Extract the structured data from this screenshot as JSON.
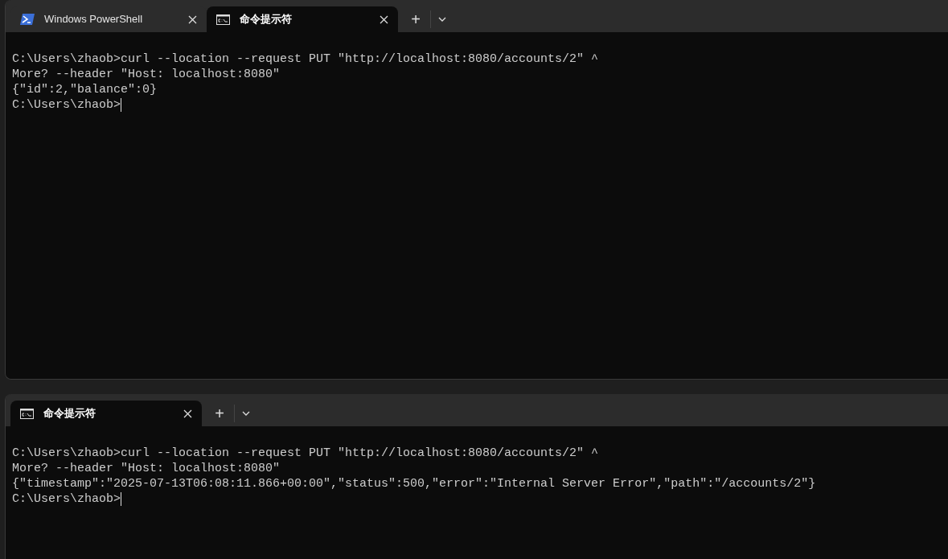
{
  "windows": [
    {
      "tabs": [
        {
          "kind": "powershell",
          "title": "Windows PowerShell",
          "selected": false
        },
        {
          "kind": "cmd",
          "title": "命令提示符",
          "selected": true
        }
      ],
      "new_tab": "+",
      "lines": [
        "C:\\Users\\zhaob>curl --location --request PUT \"http://localhost:8080/accounts/2\" ^",
        "More? --header \"Host: localhost:8080\"",
        "{\"id\":2,\"balance\":0}",
        "C:\\Users\\zhaob>"
      ]
    },
    {
      "tabs": [
        {
          "kind": "cmd",
          "title": "命令提示符",
          "selected": true
        }
      ],
      "new_tab": "+",
      "lines": [
        "C:\\Users\\zhaob>curl --location --request PUT \"http://localhost:8080/accounts/2\" ^",
        "More? --header \"Host: localhost:8080\"",
        "{\"timestamp\":\"2025-07-13T06:08:11.866+00:00\",\"status\":500,\"error\":\"Internal Server Error\",\"path\":\"/accounts/2\"}",
        "C:\\Users\\zhaob>"
      ]
    }
  ]
}
